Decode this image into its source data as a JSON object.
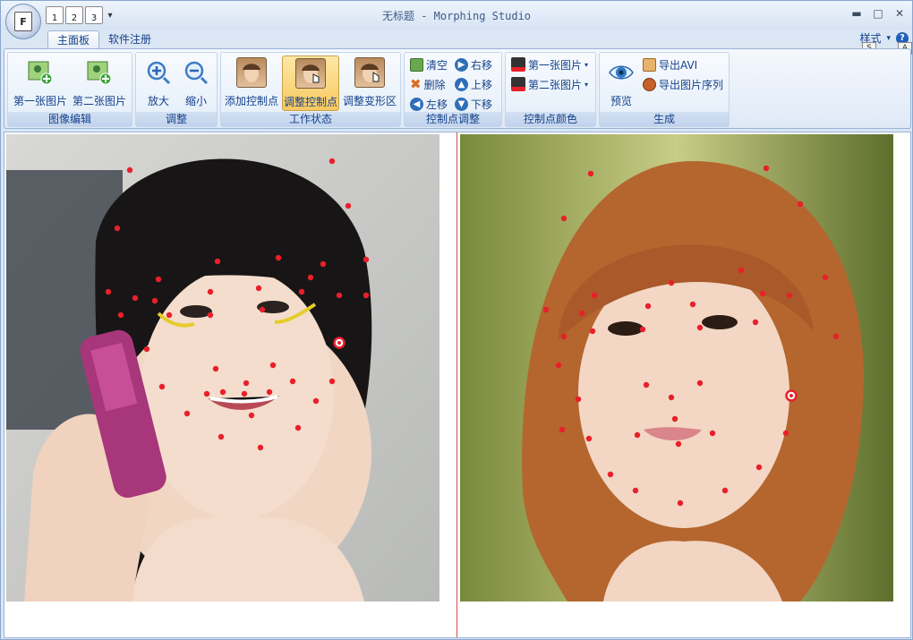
{
  "app": {
    "title": "无标题 - Morphing Studio",
    "orb_label": "F"
  },
  "quick_access": {
    "items": [
      "1",
      "2",
      "3"
    ],
    "more": "▾"
  },
  "window_controls": {
    "minimize": "▬",
    "maximize": "□",
    "close": "✕"
  },
  "tabs": [
    {
      "label": "主面板",
      "active": true
    },
    {
      "label": "软件注册",
      "active": false
    }
  ],
  "style_menu": {
    "label": "样式",
    "arrow": "▾",
    "keytip_style": "S",
    "help": "?",
    "keytip_help": "A"
  },
  "ribbon": {
    "groups": {
      "image_edit": {
        "label": "图像编辑",
        "first": "第一张图片",
        "second": "第二张图片"
      },
      "adjust": {
        "label": "调整",
        "zoom_in": "放大",
        "zoom_out": "缩小"
      },
      "work_state": {
        "label": "工作状态",
        "add_cp": "添加控制点",
        "adjust_cp": "调整控制点",
        "adjust_warp": "调整变形区"
      },
      "cp_adjust": {
        "label": "控制点调整",
        "clear": "清空",
        "delete": "删除",
        "left": "左移",
        "right": "右移",
        "up": "上移",
        "down": "下移"
      },
      "cp_color": {
        "label": "控制点颜色",
        "first": "第一张图片",
        "second": "第二张图片",
        "arrow": "▾"
      },
      "generate": {
        "label": "生成",
        "preview": "预览",
        "export_avi": "导出AVI",
        "export_seq": "导出图片序列"
      }
    }
  },
  "colors": {
    "control_point": "#e8202a",
    "accent": "#15428b",
    "pressed": "#f8c860"
  },
  "icons": {
    "qat": "document-icon",
    "clear": "trash-icon",
    "delete": "x-icon",
    "left": "arrow-left-icon",
    "right": "arrow-right-icon",
    "up": "arrow-up-icon",
    "down": "arrow-down-icon",
    "preview": "eye-icon",
    "avi": "film-icon",
    "sequence": "camera-icon"
  }
}
